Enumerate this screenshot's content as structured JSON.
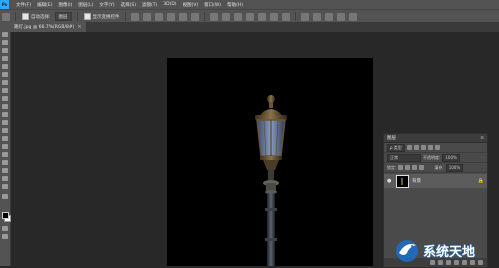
{
  "app": {
    "logo_text": "Ps",
    "menus": [
      "文件(F)",
      "编辑(E)",
      "图像(I)",
      "图层(L)",
      "文字(Y)",
      "选择(S)",
      "滤镜(T)",
      "3D(D)",
      "视图(V)",
      "窗口(W)",
      "帮助(H)"
    ]
  },
  "options_bar": {
    "auto_select_label": "自动选择:",
    "auto_select_target": "图层",
    "show_transform_label": "显示变换控件"
  },
  "document": {
    "tab_title": "路灯.jpg @ 66.7%(RGB/8#)",
    "close_glyph": "×"
  },
  "layers_panel": {
    "title": "图层",
    "menu_glyph": "≡",
    "kind_filter": "ρ 类型",
    "blend_mode": "正常",
    "opacity_label": "不透明度:",
    "opacity_value": "100%",
    "lock_label": "锁定:",
    "fill_label": "填充:",
    "fill_value": "100%",
    "layers": [
      {
        "name": "背景",
        "visible": true,
        "locked": true
      }
    ],
    "eye_glyph": "●",
    "lock_glyph": "🔒"
  },
  "watermark": {
    "text": "系统天地"
  },
  "colors": {
    "ui_panel": "#535353",
    "workspace": "#282828",
    "canvas": "#000000",
    "watermark_blue": "#1b6fc9"
  }
}
